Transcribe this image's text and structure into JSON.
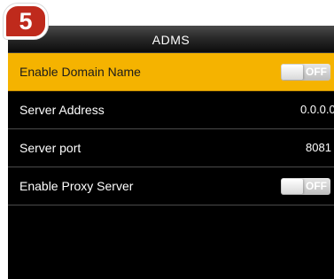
{
  "step_badge": "5",
  "window": {
    "title": "ADMS"
  },
  "colors": {
    "selected_row": "#f5b300",
    "background": "#000000",
    "badge": "#bf2a1c"
  },
  "settings": [
    {
      "label": "Enable Domain Name",
      "type": "toggle",
      "state": "OFF",
      "selected": true
    },
    {
      "label": "Server Address",
      "type": "value",
      "value": "0.0.0.0"
    },
    {
      "label": "Server port",
      "type": "value",
      "value": "8081"
    },
    {
      "label": "Enable Proxy Server",
      "type": "toggle",
      "state": "OFF",
      "selected": false
    }
  ]
}
